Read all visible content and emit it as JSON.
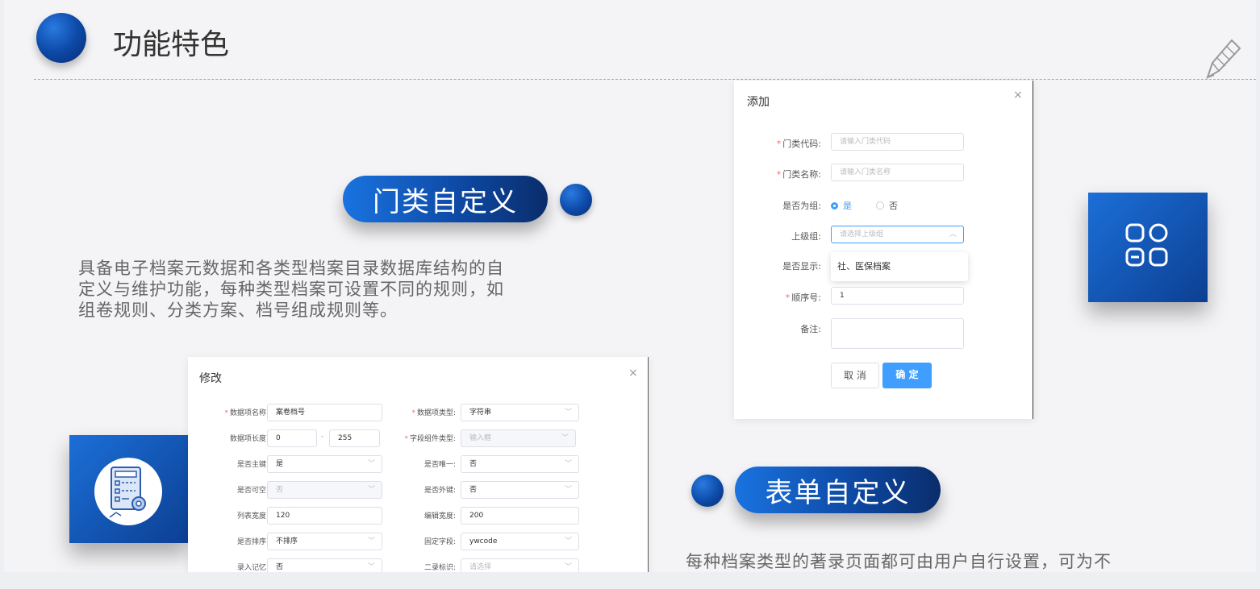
{
  "header": {
    "title": "功能特色"
  },
  "section1": {
    "pill": "门类自定义",
    "description_lines": [
      "具备电子档案元数据和各类型档案目录数据库结构的自",
      "定义与维护功能，每种类型档案可设置不同的规则，如",
      "组卷规则、分类方案、档号组成规则等。"
    ]
  },
  "section2": {
    "pill": "表单自定义",
    "description": "每种档案类型的著录页面都可由用户自行设置，可为不"
  },
  "add_dialog": {
    "title": "添加",
    "close": "×",
    "fields": {
      "code_label": "门类代码:",
      "code_placeholder": "请输入门类代码",
      "name_label": "门类名称:",
      "name_placeholder": "请输入门类名称",
      "group_label": "是否为组:",
      "group_yes": "是",
      "group_no": "否",
      "parent_label": "上级组:",
      "parent_placeholder": "请选择上级组",
      "display_label": "是否显示:",
      "dropdown_option": "社、医保档案",
      "order_label": "顺序号:",
      "order_value": "1",
      "remark_label": "备注:"
    },
    "cancel": "取 消",
    "confirm": "确 定"
  },
  "edit_dialog": {
    "title": "修改",
    "close": "×",
    "rows": [
      {
        "l_label": "数据项名称:",
        "l_req": true,
        "l_value": "案卷档号",
        "l_type": "input",
        "r_label": "数据项类型:",
        "r_req": true,
        "r_value": "字符串",
        "r_type": "select"
      },
      {
        "l_label": "数据项长度:",
        "l_req": false,
        "l_value": "0",
        "l_value2": "255",
        "l_type": "range",
        "r_label": "字段组件类型:",
        "r_req": true,
        "r_value": "输入框",
        "r_type": "select-dis"
      },
      {
        "l_label": "是否主键:",
        "l_req": false,
        "l_value": "是",
        "l_type": "select",
        "r_label": "是否唯一:",
        "r_req": false,
        "r_value": "否",
        "r_type": "select"
      },
      {
        "l_label": "是否可空:",
        "l_req": false,
        "l_value": "否",
        "l_type": "select-dis",
        "r_label": "是否外键:",
        "r_req": false,
        "r_value": "否",
        "r_type": "select"
      },
      {
        "l_label": "列表宽度:",
        "l_req": false,
        "l_value": "120",
        "l_type": "input",
        "r_label": "编辑宽度:",
        "r_req": false,
        "r_value": "200",
        "r_type": "input"
      },
      {
        "l_label": "是否排序:",
        "l_req": false,
        "l_value": "不排序",
        "l_type": "select",
        "r_label": "固定字段:",
        "r_req": false,
        "r_value": "ywcode",
        "r_type": "select"
      },
      {
        "l_label": "录入记忆:",
        "l_req": false,
        "l_value": "否",
        "l_type": "select",
        "r_label": "二录标识:",
        "r_req": false,
        "r_value": "请选择",
        "r_type": "select-ph"
      }
    ]
  },
  "colors": {
    "accent": "#0d47a1",
    "primary_button": "#409eff"
  },
  "icons": [
    "dashboard-grid-icon",
    "document-settings-icon",
    "pencil-icon"
  ]
}
